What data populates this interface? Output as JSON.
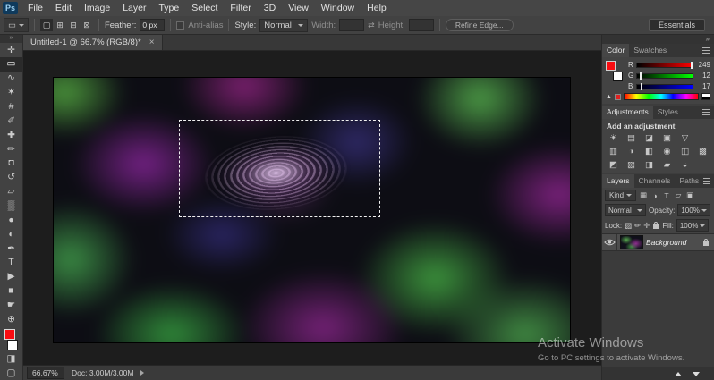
{
  "app": {
    "logo_text": "Ps",
    "workspace": "Essentials"
  },
  "menubar": {
    "items": [
      "File",
      "Edit",
      "Image",
      "Layer",
      "Type",
      "Select",
      "Filter",
      "3D",
      "View",
      "Window",
      "Help"
    ]
  },
  "options": {
    "tool_preset_glyph": "▭",
    "selection_modes": [
      {
        "name": "new-selection",
        "glyph": "▢"
      },
      {
        "name": "add-to-selection",
        "glyph": "⊞"
      },
      {
        "name": "subtract-from-selection",
        "glyph": "⊟"
      },
      {
        "name": "intersect-selection",
        "glyph": "⊠"
      }
    ],
    "feather_label": "Feather:",
    "feather_value": "0 px",
    "antialias_label": "Anti-alias",
    "style_label": "Style:",
    "style_value": "Normal",
    "width_label": "Width:",
    "swap_glyph": "⇄",
    "height_label": "Height:",
    "refine_edge_label": "Refine Edge..."
  },
  "tab": {
    "title": "Untitled-1 @ 66.7% (RGB/8)*",
    "close_glyph": "×"
  },
  "toolbar": {
    "collapse_glyph": "»",
    "tools": [
      {
        "name": "move-tool",
        "glyph": "✛"
      },
      {
        "name": "rectangular-marquee-tool",
        "glyph": "▭"
      },
      {
        "name": "lasso-tool",
        "glyph": "∿"
      },
      {
        "name": "quick-selection-tool",
        "glyph": "✶"
      },
      {
        "name": "crop-tool",
        "glyph": "#"
      },
      {
        "name": "eyedropper-tool",
        "glyph": "✐"
      },
      {
        "name": "spot-healing-brush-tool",
        "glyph": "✚"
      },
      {
        "name": "brush-tool",
        "glyph": "✏"
      },
      {
        "name": "clone-stamp-tool",
        "glyph": "◘"
      },
      {
        "name": "history-brush-tool",
        "glyph": "↺"
      },
      {
        "name": "eraser-tool",
        "glyph": "▱"
      },
      {
        "name": "gradient-tool",
        "glyph": "▒"
      },
      {
        "name": "blur-tool",
        "glyph": "●"
      },
      {
        "name": "dodge-tool",
        "glyph": "◐"
      },
      {
        "name": "pen-tool",
        "glyph": "✒"
      },
      {
        "name": "type-tool",
        "glyph": "T"
      },
      {
        "name": "path-selection-tool",
        "glyph": "▶"
      },
      {
        "name": "shape-tool",
        "glyph": "■"
      },
      {
        "name": "hand-tool",
        "glyph": "☛"
      },
      {
        "name": "zoom-tool",
        "glyph": "⊕"
      }
    ],
    "quick_mask_glyph": "◨",
    "screen_mode_glyph": "▢"
  },
  "colors": {
    "foreground": "#f90c11",
    "background": "#ffffff"
  },
  "panels": {
    "dock_collapse_glyph": "»",
    "color": {
      "tabs": [
        "Color",
        "Swatches"
      ],
      "channels": [
        {
          "label": "R",
          "value": "249",
          "pos": "97%"
        },
        {
          "label": "G",
          "value": "12",
          "pos": "5%"
        },
        {
          "label": "B",
          "value": "17",
          "pos": "7%"
        }
      ],
      "gamut_warning_glyph": "▲"
    },
    "adjustments": {
      "tabs": [
        "Adjustments",
        "Styles"
      ],
      "title": "Add an adjustment",
      "icons": [
        {
          "name": "brightness-contrast",
          "glyph": "☀"
        },
        {
          "name": "levels",
          "glyph": "▤"
        },
        {
          "name": "curves",
          "glyph": "◪"
        },
        {
          "name": "exposure",
          "glyph": "▣"
        },
        {
          "name": "vibrance",
          "glyph": "▽"
        },
        {
          "name": "hue-saturation",
          "glyph": "▥"
        },
        {
          "name": "color-balance",
          "glyph": "◑"
        },
        {
          "name": "black-white",
          "glyph": "◧"
        },
        {
          "name": "photo-filter",
          "glyph": "◉"
        },
        {
          "name": "channel-mixer",
          "glyph": "◫"
        },
        {
          "name": "color-lookup",
          "glyph": "▩"
        },
        {
          "name": "invert",
          "glyph": "◩"
        },
        {
          "name": "posterize",
          "glyph": "▨"
        },
        {
          "name": "threshold",
          "glyph": "◨"
        },
        {
          "name": "gradient-map",
          "glyph": "▰"
        },
        {
          "name": "selective-color",
          "glyph": "◒"
        }
      ]
    },
    "layers": {
      "tabs": [
        "Layers",
        "Channels",
        "Paths"
      ],
      "kind_label": "Kind",
      "filter_icons": [
        {
          "name": "pixel-layer-filter",
          "glyph": "▦"
        },
        {
          "name": "adjustment-layer-filter",
          "glyph": "◑"
        },
        {
          "name": "type-layer-filter",
          "glyph": "T"
        },
        {
          "name": "shape-layer-filter",
          "glyph": "▱"
        },
        {
          "name": "smart-object-filter",
          "glyph": "▣"
        }
      ],
      "blend_mode": "Normal",
      "opacity_label": "Opacity:",
      "opacity_value": "100%",
      "lock_label": "Lock:",
      "lock_icons": [
        {
          "name": "lock-transparency",
          "glyph": "▨"
        },
        {
          "name": "lock-pixels",
          "glyph": "✏"
        },
        {
          "name": "lock-position",
          "glyph": "✛"
        }
      ],
      "fill_label": "Fill:",
      "fill_value": "100%",
      "rows": [
        {
          "name": "Background"
        }
      ]
    }
  },
  "statusbar": {
    "zoom": "66.67%",
    "doc_info": "Doc: 3.00M/3.00M"
  },
  "watermark": {
    "line1": "Activate Windows",
    "line2": "Go to PC settings to activate Windows."
  }
}
